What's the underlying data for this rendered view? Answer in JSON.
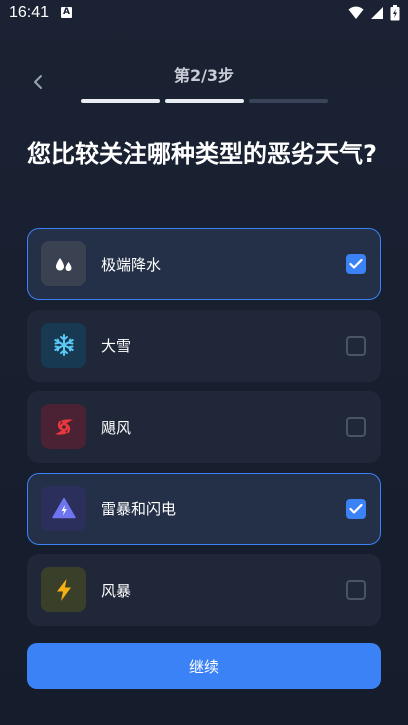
{
  "status_bar": {
    "time": "16:41",
    "notification_badge": "A",
    "icons": [
      "wifi-icon",
      "signal-icon",
      "battery-icon"
    ]
  },
  "header": {
    "step_label": "第2/3步",
    "progress": {
      "current_step": 2,
      "total_steps": 3
    }
  },
  "question": "您比较关注哪种类型的恶劣天气?",
  "options": [
    {
      "label": "极端降水",
      "icon": "water-drops-icon",
      "icon_bg": "#3a4252",
      "selected": true
    },
    {
      "label": "大雪",
      "icon": "snowflake-icon",
      "icon_bg": "#173a52",
      "selected": false
    },
    {
      "label": "飓风",
      "icon": "hurricane-icon",
      "icon_bg": "#4a2233",
      "selected": false
    },
    {
      "label": "雷暴和闪电",
      "icon": "thunderstorm-icon",
      "icon_bg": "#2a2f5c",
      "selected": true
    },
    {
      "label": "风暴",
      "icon": "lightning-bolt-icon",
      "icon_bg": "#3a3f2a",
      "selected": false
    }
  ],
  "continue_label": "继续",
  "colors": {
    "accent": "#3b82f6",
    "background": "#1a2233",
    "card": "#1f2738",
    "card_selected": "#243048"
  }
}
